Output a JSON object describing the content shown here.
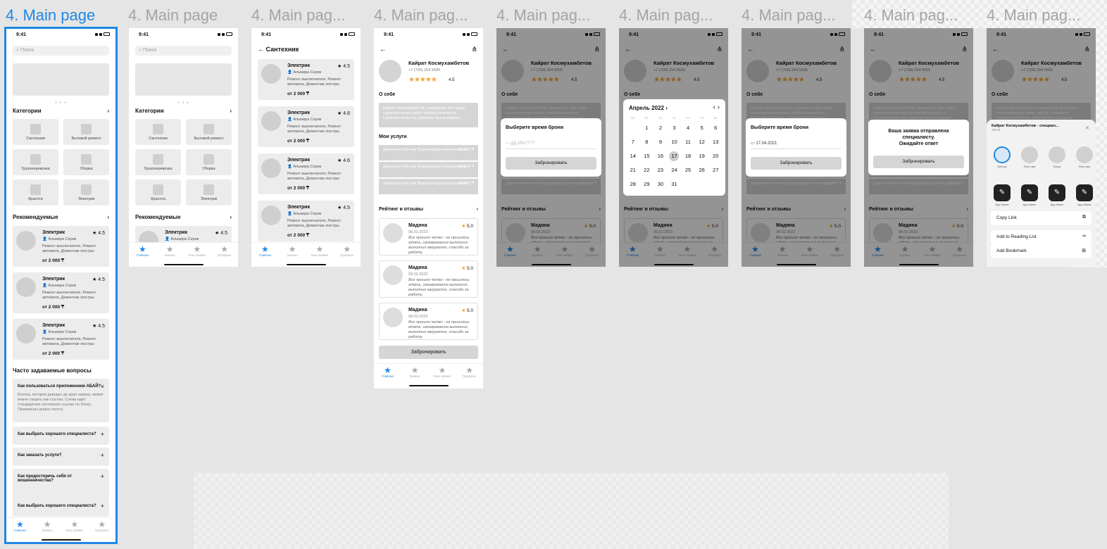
{
  "frame_labels": [
    "4. Main page",
    "4. Main page",
    "4. Main pag...",
    "4. Main pag...",
    "4. Main pag...",
    "4. Main pag...",
    "4. Main pag...",
    "4. Main pag...",
    "4. Main pag..."
  ],
  "status_time": "9:41",
  "search_placeholder": "Поиск",
  "categories_title": "Категории",
  "categories": [
    "Сантехник",
    "Бытовой ремонт",
    "Грузоперевозка",
    "Уборка",
    "Красота",
    "Электрик"
  ],
  "recommended_title": "Рекомендуемые",
  "specialist": {
    "name": "Электрик",
    "rating": "4.5",
    "owner": "Альмира Серик",
    "desc": "Ремонт выключателя, Ремонт автомата, Демонтаж люстры",
    "price": "от 2 000 ₸"
  },
  "faq_title": "Часто задаваемые вопросы",
  "faq": [
    {
      "q": "Как пользоваться приложением АБАЙ?",
      "a": "Кнопка, которая доводит до края экрана, может иначе тащить как ссылка. Слева идет стандартная системная ссылка по блоку. Примерная длина текста."
    },
    {
      "q": "Как выбрать хорошего специалиста?"
    },
    {
      "q": "Как заказать услуги?"
    },
    {
      "q": "Как предостеречь себя от мошенничества?"
    },
    {
      "q": "Как выбрать хорошего специалиста?"
    }
  ],
  "tabs": [
    "Главная",
    "Заказы",
    "Мои заявки",
    "Профиль"
  ],
  "list_title": "Сантехник",
  "list_ratings": [
    "4.5",
    "4.6",
    "4.6",
    "4.5"
  ],
  "profile": {
    "name": "Кайрат Космухамбетов",
    "phone": "+7 (700) 254 5695",
    "rating": "4.5",
    "stars": "★★★★★"
  },
  "about_title": "О себе",
  "about_text": "Кайрат Космухамбетов, универсал. Все виды сантехнических работ любой сложности. Гарантия качества, работаю без выходных.",
  "services_title": "Мои услуги",
  "services": [
    {
      "name": "Демонтаж Монтаж Водопровода Канализации",
      "price": "25 000 ₸"
    },
    {
      "name": "Демонтаж Монтаж Водопровода Канализации",
      "price": "25 000 ₸"
    },
    {
      "name": "Демонтаж Монтаж Водопровода Канализации",
      "price": "25 000 ₸"
    }
  ],
  "reviews_title": "Рейтинг и отзывы",
  "review": {
    "name": "Мадина",
    "date": "08.02.2022",
    "score": "5.0",
    "text": "Все прошло четко - не пришлось ждать, своевременно выполнил, выполнил аккуратно, спасибо за работу."
  },
  "book_label": "Забронировать",
  "modal_title": "Выберите время брони",
  "date_placeholder": "ДД.ММ.ГГГГ",
  "date_value": "17.04.2021",
  "calendar": {
    "month": "Апрель 2022",
    "weekdays": [
      "Пн",
      "Вт",
      "Ср",
      "Чт",
      "Пт",
      "Сб",
      "Вс"
    ],
    "days": [
      "",
      "1",
      "2",
      "3",
      "4",
      "5",
      "6",
      "7",
      "8",
      "9",
      "10",
      "11",
      "12",
      "13",
      "14",
      "15",
      "16",
      "17",
      "18",
      "19",
      "20",
      "21",
      "22",
      "23",
      "24",
      "25",
      "26",
      "27",
      "28",
      "29",
      "30",
      "31"
    ],
    "selected": "17"
  },
  "sent_line1": "Ваша заявка отправлена специалисту.",
  "sent_line2": "Ожидайте ответ",
  "share": {
    "title": "Кайрат Космухамбетов - специал...",
    "sub": "АБАЙ",
    "people": [
      "AirDrop",
      "First Last",
      "Group",
      "First Last"
    ],
    "apps": [
      "App Name",
      "App Name",
      "App Name",
      "App Name"
    ],
    "rows": [
      "Copy Link",
      "Add to Reading List",
      "Add Bookmark"
    ]
  }
}
